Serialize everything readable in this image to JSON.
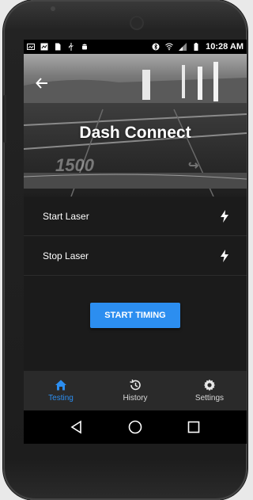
{
  "status_bar": {
    "time": "10:28 AM",
    "left_icons": [
      "image-icon",
      "gallery-icon",
      "document-icon",
      "usb-icon",
      "android-icon"
    ],
    "right_icons": [
      "bluetooth-icon",
      "wifi-icon",
      "signal-icon",
      "battery-icon"
    ]
  },
  "header": {
    "title": "Dash Connect",
    "back_icon": "back-arrow-icon",
    "road_marking": "1500"
  },
  "controls": [
    {
      "label": "Start Laser",
      "icon": "bolt-icon"
    },
    {
      "label": "Stop Laser",
      "icon": "bolt-icon"
    }
  ],
  "action": {
    "label": "START TIMING",
    "color": "#2c8ef0"
  },
  "bottom_nav": [
    {
      "label": "Testing",
      "icon": "home-icon",
      "active": true
    },
    {
      "label": "History",
      "icon": "history-icon",
      "active": false
    },
    {
      "label": "Settings",
      "icon": "gear-icon",
      "active": false
    }
  ],
  "system_nav": [
    "back-triangle-icon",
    "home-circle-icon",
    "recents-square-icon"
  ],
  "colors": {
    "accent": "#2c8ef0",
    "background": "#1b1b1b",
    "nav_background": "#2a2a2a"
  }
}
